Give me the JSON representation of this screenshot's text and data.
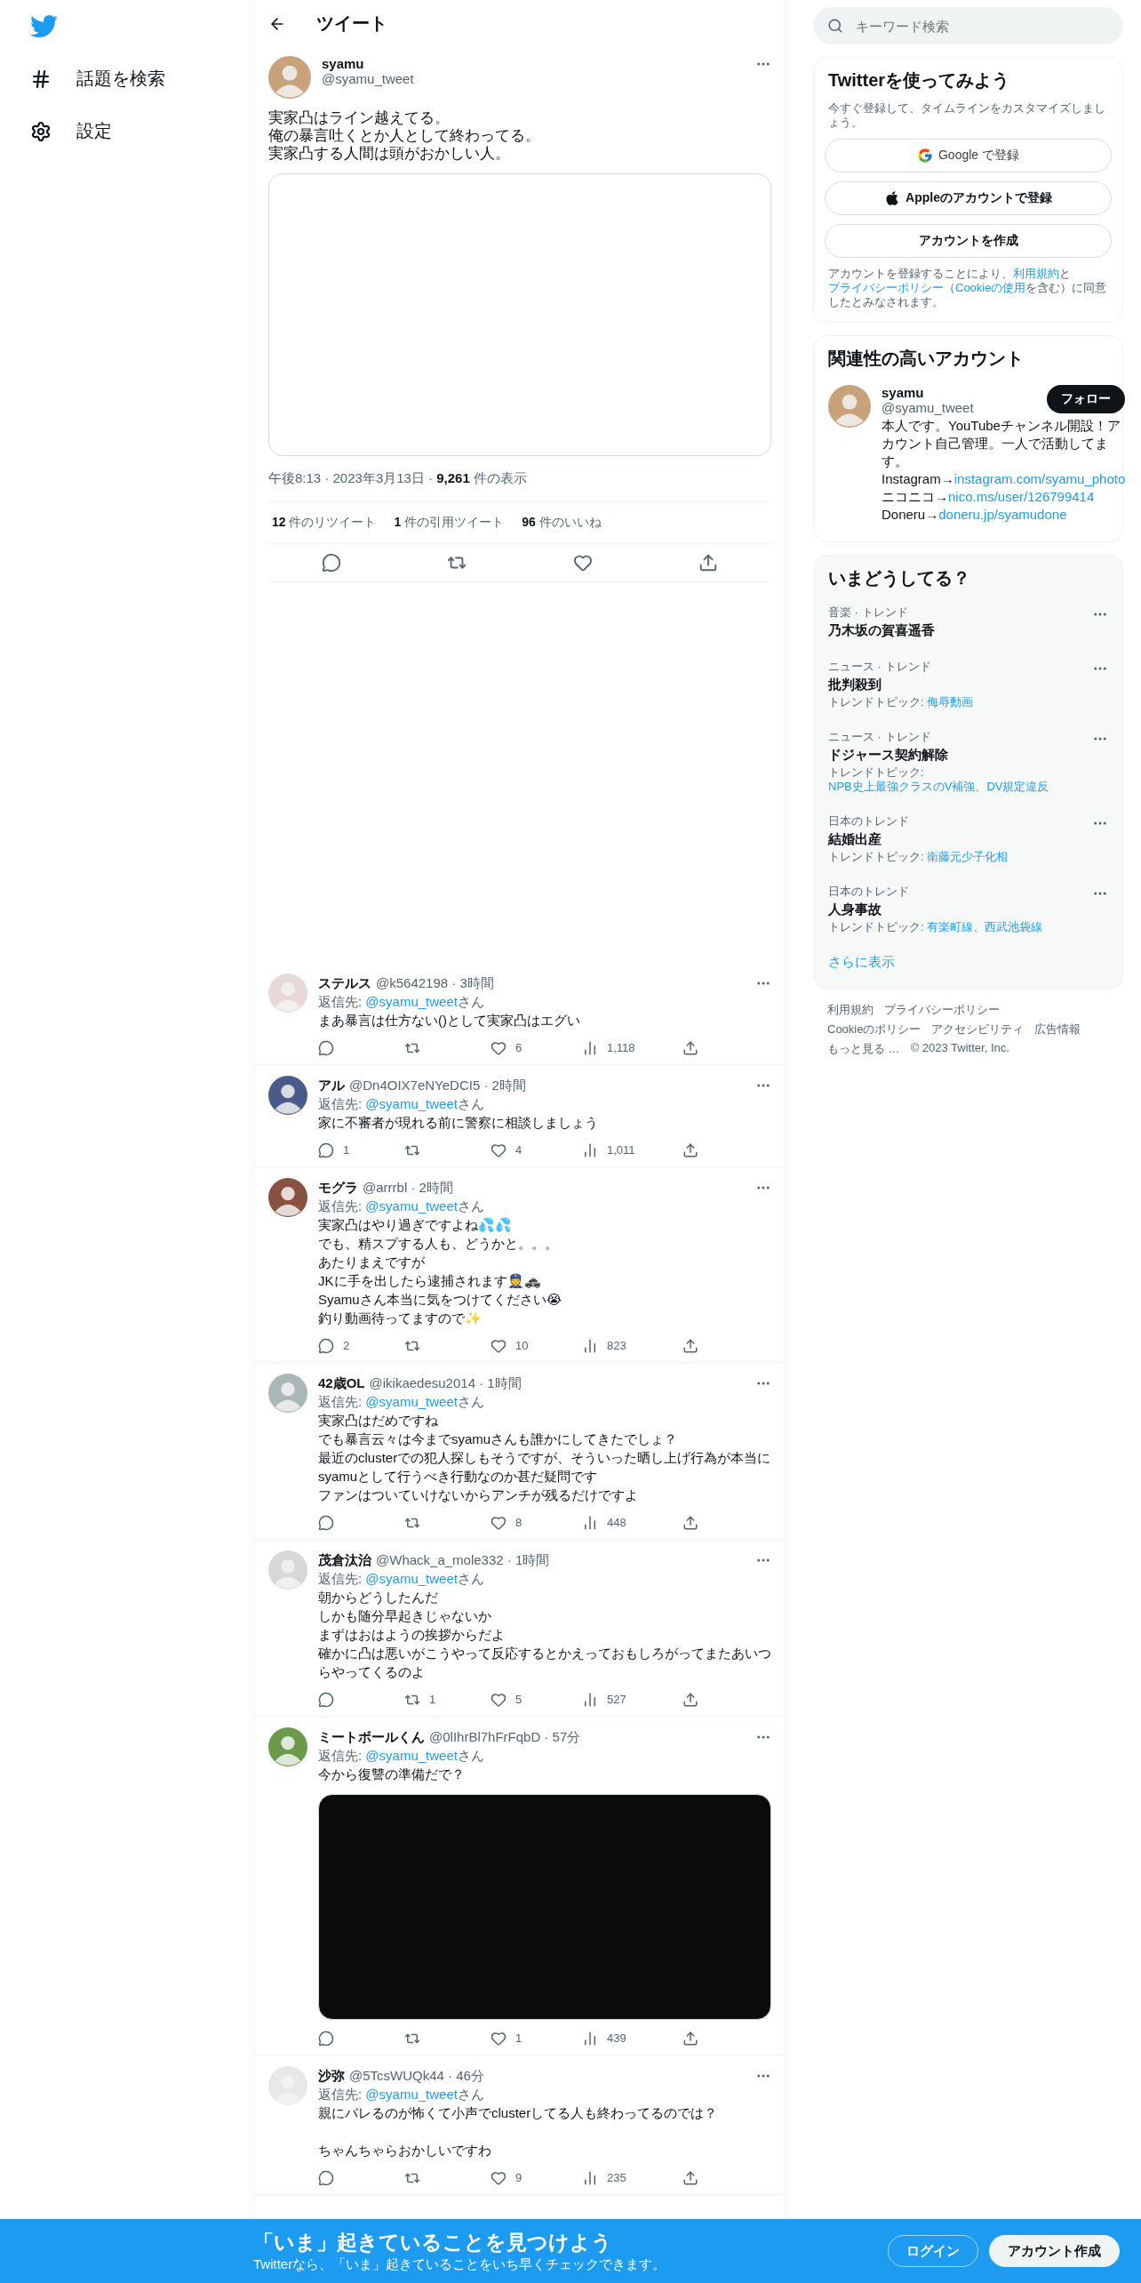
{
  "sidebar": {
    "items": [
      {
        "kind": "explore",
        "label": "話題を検索"
      },
      {
        "kind": "settings",
        "label": "設定"
      }
    ]
  },
  "header": {
    "title": "ツイート"
  },
  "tweet": {
    "name": "syamu",
    "handle": "@syamu_tweet",
    "lines": [
      "実家凸はライン越えてる。",
      "俺の暴言吐くとか人として終わってる。",
      "実家凸する人間は頭がおかしい人。"
    ],
    "meta": "午後8:13 · 2023年3月13日 · **9,261** 件の表示",
    "stats": [
      "**12** 件のリツイート",
      "**1** 件の引用ツイート",
      "**96** 件のいいね"
    ]
  },
  "replies": [
    {
      "name": "ステルス",
      "handle_time": "@k5642198 · 3時間",
      "reply_label": "返信先: ",
      "reply_to": "@syamu_tweet",
      "reply_suffix": "さん",
      "paragraphs": [
        [
          "まあ暴言は仕方ない()として実家凸はエグい"
        ]
      ],
      "likes": "6",
      "views": "1,118"
    },
    {
      "name": "アル",
      "handle_time": "@Dn4OIX7eNYeDCI5 · 2時間",
      "reply_label": "返信先: ",
      "reply_to": "@syamu_tweet",
      "reply_suffix": "さん",
      "paragraphs": [
        [
          "家に不審者が現れる前に警察に相談しましょう"
        ]
      ],
      "replies": "1",
      "likes": "4",
      "views": "1,011"
    },
    {
      "name": "モグラ",
      "handle_time": "@arrrbl · 2時間",
      "reply_label": "返信先: ",
      "reply_to": "@syamu_tweet",
      "reply_suffix": "さん",
      "paragraphs": [
        [
          "実家凸はやり過ぎですよね💦💦",
          "でも、精スプする人も、どうかと。。。",
          "あたりまえですが",
          "JKに手を出したら逮捕されます👮🚓",
          "Syamuさん本当に気をつけてください😭",
          "釣り動画待ってますので✨"
        ]
      ],
      "replies": "2",
      "likes": "10",
      "views": "823"
    },
    {
      "name": "42歳OL",
      "handle_time": "@ikikaedesu2014 · 1時間",
      "reply_label": "返信先: ",
      "reply_to": "@syamu_tweet",
      "reply_suffix": "さん",
      "paragraphs": [
        [
          "実家凸はだめですね",
          "でも暴言云々は今までsyamuさんも誰かにしてきたでしょ？",
          "最近のclusterでの犯人探しもそうですが、そういった晒し上げ行為が本当にsyamuとして行うべき行動なのか甚だ疑問です",
          "ファンはついていけないからアンチが残るだけですよ"
        ]
      ],
      "likes": "8",
      "views": "448"
    },
    {
      "name": "茂倉汰治",
      "handle_time": "@Whack_a_mole332 · 1時間",
      "reply_label": "返信先: ",
      "reply_to": "@syamu_tweet",
      "reply_suffix": "さん",
      "paragraphs": [
        [
          "朝からどうしたんだ",
          "しかも随分早起きじゃないか",
          "まずはおはようの挨拶からだよ",
          "確かに凸は悪いがこうやって反応するとかえっておもしろがってまたあいつらやってくるのよ"
        ]
      ],
      "retweets": "1",
      "likes": "5",
      "views": "527"
    },
    {
      "name": "ミートボールくん",
      "handle_time": "@0lIhrBl7hFrFqbD · 57分",
      "reply_label": "返信先: ",
      "reply_to": "@syamu_tweet",
      "reply_suffix": "さん",
      "paragraphs": [
        [
          "今から復讐の準備だで？"
        ]
      ],
      "media": {
        "kind": "video"
      },
      "likes": "1",
      "views": "439"
    },
    {
      "name": "沙弥",
      "handle_time": "@5TcsWUQk44 · 46分",
      "reply_label": "返信先: ",
      "reply_to": "@syamu_tweet",
      "reply_suffix": "さん",
      "paragraphs": [
        [
          "親にバレるのが怖くて小声でclusterしてる人も終わってるのでは？"
        ],
        [
          "ちゃんちゃらおかしいですわ"
        ]
      ],
      "likes": "9",
      "views": "235"
    }
  ],
  "search": {
    "placeholder": "キーワード検索"
  },
  "signup": {
    "title": "Twitterを使ってみよう",
    "subtitle": "今すぐ登録して、タイムラインをカスタマイズしましょう。",
    "buttons": [
      {
        "kind": "google",
        "label": "Google で登録"
      },
      {
        "kind": "apple",
        "label": "Appleのアカウントで登録"
      },
      {
        "kind": "create",
        "label": "アカウントを作成"
      }
    ],
    "legal": [
      {
        "text": "アカウントを登録することにより、",
        "link": false
      },
      {
        "text": "利用規約",
        "link": true
      },
      {
        "text": "と",
        "link": false
      },
      {
        "text": "プライバシーポリシー",
        "link": true
      },
      {
        "text": "（",
        "link": false
      },
      {
        "text": "Cookieの使用",
        "link": true
      },
      {
        "text": "を含む）に同意したとみなされます。",
        "link": false
      }
    ]
  },
  "related": {
    "title": "関連性の高いアカウント",
    "name": "syamu",
    "handle": "@syamu_tweet",
    "follow": "フォロー",
    "bio": [
      {
        "text": "本人です。YouTubeチャンネル開設！アカウント自己管理。一人で活動してます。 Instagram→",
        "link": false
      },
      {
        "text": "instagram.com/syamu_photo",
        "link": true
      },
      {
        "text": " ニコニコ→",
        "link": false
      },
      {
        "text": "nico.ms/user/126799414",
        "link": true
      },
      {
        "text": " Doneru→",
        "link": false
      },
      {
        "text": "doneru.jp/syamudone",
        "link": true
      }
    ]
  },
  "trends": {
    "title": "いまどうしてる？",
    "items": [
      {
        "context": "音楽 · トレンド",
        "title": "乃木坂の賀喜遥香"
      },
      {
        "context": "ニュース · トレンド",
        "title": "批判殺到",
        "topic_label": "トレンドトピック: ",
        "topics": [
          "侮辱動画"
        ]
      },
      {
        "context": "ニュース · トレンド",
        "title": "ドジャース契約解除",
        "topic_label": "トレンドトピック: ",
        "topics": [
          "NPB史上最強クラスのV補強",
          "DV規定違反"
        ]
      },
      {
        "context": "日本のトレンド",
        "title": "結婚出産",
        "topic_label": "トレンドトピック: ",
        "topics": [
          "衛藤元少子化相"
        ]
      },
      {
        "context": "日本のトレンド",
        "title": "人身事故",
        "topic_label": "トレンドトピック: ",
        "topics": [
          "有楽町線",
          "西武池袋線"
        ]
      }
    ],
    "topic_separator": "、",
    "more": "さらに表示"
  },
  "footer": {
    "links": [
      "利用規約",
      "プライバシーポリシー",
      "Cookieのポリシー",
      "アクセシビリティ",
      "広告情報",
      "もっと見る …"
    ],
    "copyright": "© 2023 Twitter, Inc."
  },
  "banner": {
    "title": "「いま」起きていることを見つけよう",
    "subtitle": "Twitterなら、「いま」起きていることをいち早くチェックできます。",
    "login": "ログイン",
    "signup": "アカウント作成"
  }
}
